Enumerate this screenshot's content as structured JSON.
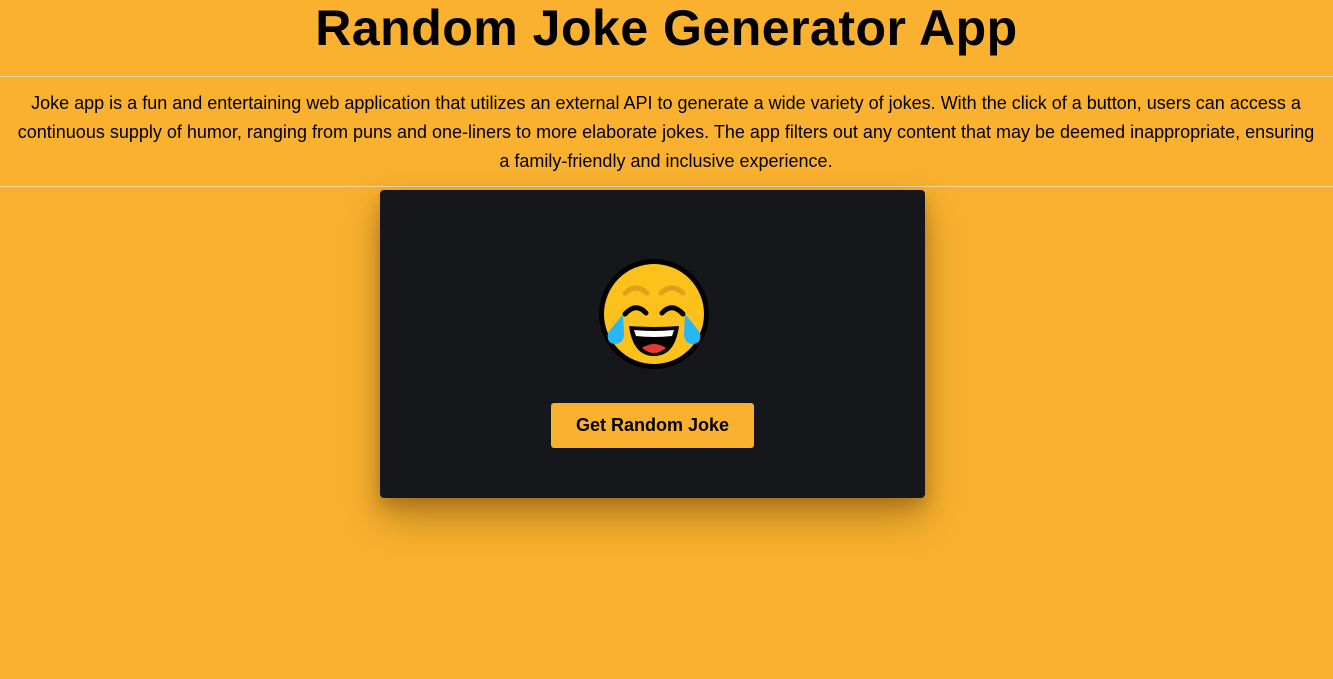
{
  "header": {
    "title": "Random Joke Generator App"
  },
  "intro": {
    "description": "Joke app is a fun and entertaining web application that utilizes an external API to generate a wide variety of jokes. With the click of a button, users can access a continuous supply of humor, ranging from puns and one-liners to more elaborate jokes. The app filters out any content that may be deemed inappropriate, ensuring a family-friendly and inclusive experience."
  },
  "card": {
    "emoji_icon": "face-with-tears-of-joy-icon",
    "button_label": "Get Random Joke"
  },
  "colors": {
    "background": "#f9b12f",
    "card": "#15171b",
    "button": "#f9b12f",
    "text": "#000000"
  }
}
